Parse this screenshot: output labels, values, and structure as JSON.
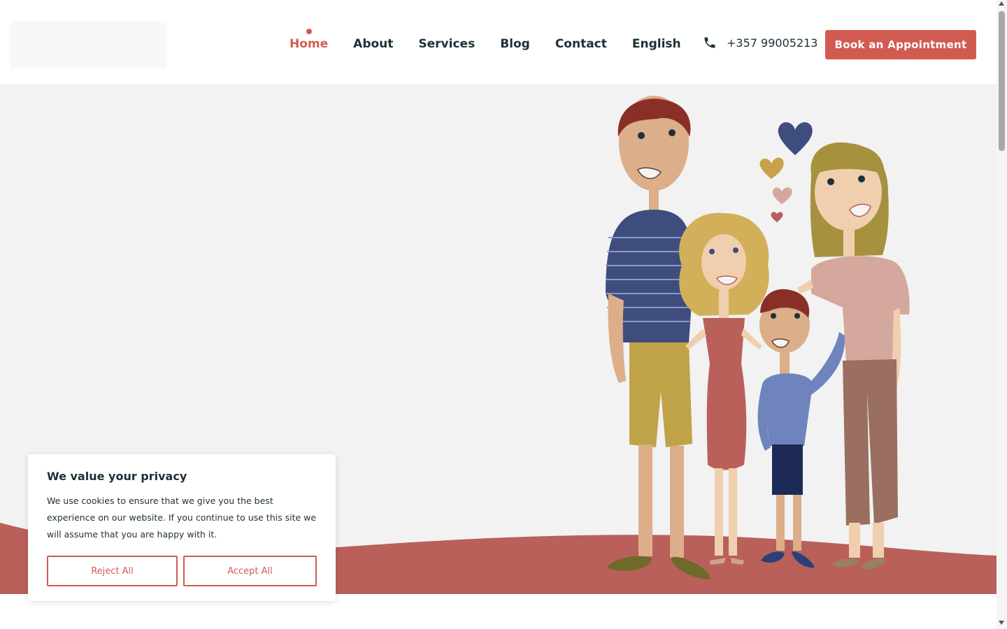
{
  "header": {
    "nav": [
      {
        "label": "Home",
        "active": true
      },
      {
        "label": "About"
      },
      {
        "label": "Services"
      },
      {
        "label": "Blog"
      },
      {
        "label": "Contact"
      },
      {
        "label": "English"
      }
    ],
    "phone": "+357 99005213",
    "book_label": "Book an Appointment"
  },
  "cookie": {
    "title": "We value your privacy",
    "text": "We use cookies to ensure that we give you the best experience on our website. If you continue to use this site we will assume that you are happy with it.",
    "reject_label": "Reject All",
    "accept_label": "Accept All"
  },
  "colors": {
    "accent": "#d25b51",
    "text": "#1e3038",
    "hero_bg": "#f2f2f2",
    "wave": "#b9605a"
  },
  "icons": [
    "phone-icon"
  ]
}
